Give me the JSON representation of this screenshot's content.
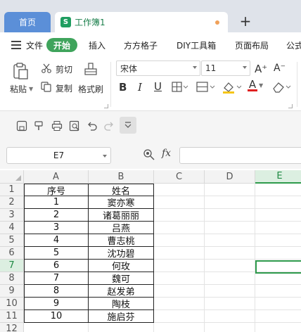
{
  "tabs": {
    "home": "首页",
    "doc_icon": "S",
    "doc": "工作簿1",
    "plus": "+"
  },
  "menu": {
    "file": "文件",
    "start": "开始",
    "insert": "插入",
    "ffgz": "方方格子",
    "diy": "DIY工具箱",
    "layout": "页面布局",
    "formula": "公式"
  },
  "ribbon": {
    "paste": "粘贴",
    "cut": "剪切",
    "copy": "复制",
    "format_painter": "格式刷",
    "font_name": "宋体",
    "font_size": "11",
    "bold": "B",
    "italic": "I",
    "underline": "U",
    "font_color": "A",
    "grow": "A⁺",
    "shrink": "A⁻"
  },
  "formula_bar": {
    "cell_ref": "E7",
    "fx": "fx",
    "value": ""
  },
  "sheet": {
    "columns": [
      "A",
      "B",
      "C",
      "D",
      "E"
    ],
    "active_column": "E",
    "active_row": 7,
    "rows": [
      {
        "num": "1",
        "a": "序号",
        "b": "姓名"
      },
      {
        "num": "2",
        "a": "1",
        "b": "窦亦寒"
      },
      {
        "num": "3",
        "a": "2",
        "b": "诸葛丽丽"
      },
      {
        "num": "4",
        "a": "3",
        "b": "吕燕"
      },
      {
        "num": "5",
        "a": "4",
        "b": "曹志桃"
      },
      {
        "num": "6",
        "a": "5",
        "b": "沈功碧"
      },
      {
        "num": "7",
        "a": "6",
        "b": "何玫"
      },
      {
        "num": "8",
        "a": "7",
        "b": "魏可"
      },
      {
        "num": "9",
        "a": "8",
        "b": "赵发弟"
      },
      {
        "num": "10",
        "a": "9",
        "b": "陶枝"
      },
      {
        "num": "11",
        "a": "10",
        "b": "施启芬"
      },
      {
        "num": "12",
        "a": "",
        "b": ""
      }
    ]
  },
  "colors": {
    "accent": "#2e9a4c",
    "home_tab": "#5b8fd8",
    "start_pill": "#3fa45c"
  }
}
